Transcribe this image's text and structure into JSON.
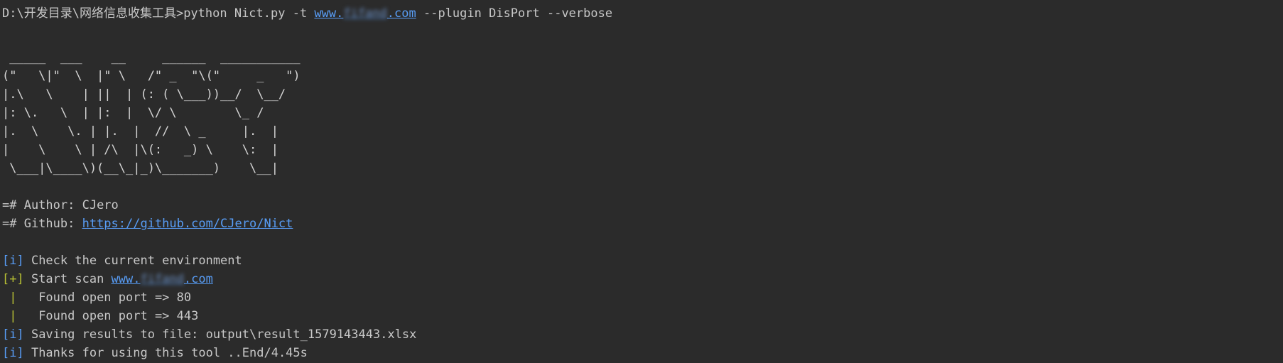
{
  "command": {
    "prompt": "D:\\开发目录\\网络信息收集工具>",
    "cmd_before_url": "python Nict.py -t ",
    "url_prefix": "www.",
    "url_hidden": "fifand",
    "url_suffix": ".com",
    "cmd_after_url": " --plugin DisPort --verbose"
  },
  "banner": [
    " _____  ___    __     ______  ___________",
    "(\"   \\|\"  \\  |\" \\   /\" _  \"\\(\"     _   \")",
    "|.\\   \\    | ||  | (: ( \\___))__/  \\__/",
    "|: \\.   \\  | |:  |  \\/ \\        \\_ /",
    "|.  \\    \\. | |.  |  //  \\ _     |.  |",
    "|    \\    \\ | /\\  |\\(:   _) \\    \\:  |",
    " \\___|\\____\\)(__\\_|_)\\_______)    \\__|"
  ],
  "info": {
    "author_prefix": "=# Author: ",
    "author_name": "CJero",
    "github_prefix": "=# Github: ",
    "github_url": "https://github.com/CJero/Nict"
  },
  "log": {
    "tag_info": "[i]",
    "tag_plus": "[+]",
    "pipe": " | ",
    "check_env": " Check the current environment",
    "start_scan": " Start scan ",
    "port_80": "  Found open port => 80",
    "port_443": "  Found open port => 443",
    "saving": " Saving results to file: output\\result_1579143443.xlsx",
    "thanks": " Thanks for using this tool ..End/4.45s"
  },
  "colors": {
    "background": "#2b2b2b",
    "text": "#c8c8c8",
    "link": "#589df6",
    "info_tag": "#589df6",
    "plus_tag": "#b8c034"
  }
}
